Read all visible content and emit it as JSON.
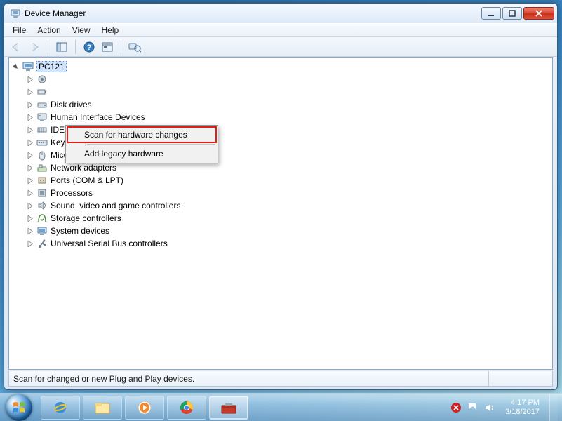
{
  "window": {
    "title": "Device Manager"
  },
  "menubar": [
    "File",
    "Action",
    "View",
    "Help"
  ],
  "toolbar": {
    "back": "Back",
    "forward": "Forward",
    "up": "Show/Hide Console Tree",
    "help": "Help",
    "props": "Properties",
    "scan": "Scan for hardware changes"
  },
  "tree": {
    "root": "PC121",
    "items": [
      {
        "label": "Disk drives",
        "icon": "drive"
      },
      {
        "label": "Human Interface Devices",
        "icon": "hid"
      },
      {
        "label": "IDE ATA/ATAPI controllers",
        "icon": "ide"
      },
      {
        "label": "Keyboards",
        "icon": "keyboard"
      },
      {
        "label": "Mice and other pointing devices",
        "icon": "mouse"
      },
      {
        "label": "Network adapters",
        "icon": "network"
      },
      {
        "label": "Ports (COM & LPT)",
        "icon": "port"
      },
      {
        "label": "Processors",
        "icon": "processor"
      },
      {
        "label": "Sound, video and game controllers",
        "icon": "sound"
      },
      {
        "label": "Storage controllers",
        "icon": "storage"
      },
      {
        "label": "System devices",
        "icon": "system"
      },
      {
        "label": "Universal Serial Bus controllers",
        "icon": "usb"
      }
    ],
    "truncated_above_context_menu": [
      {
        "icon": "gear"
      },
      {
        "icon": "battery"
      }
    ]
  },
  "context_menu": {
    "items": [
      {
        "label": "Scan for hardware changes",
        "highlight": true
      },
      {
        "label": "Add legacy hardware",
        "highlight": false
      }
    ]
  },
  "statusbar": {
    "text": "Scan for changed or new Plug and Play devices."
  },
  "taskbar": {
    "items": [
      "Internet Explorer",
      "File Explorer",
      "Windows Media Player",
      "Google Chrome",
      "Toolbox"
    ],
    "active_index": 4
  },
  "tray": {
    "icons": [
      "antivirus",
      "action-center",
      "volume"
    ],
    "time": "4:17 PM",
    "date": "3/18/2017"
  }
}
